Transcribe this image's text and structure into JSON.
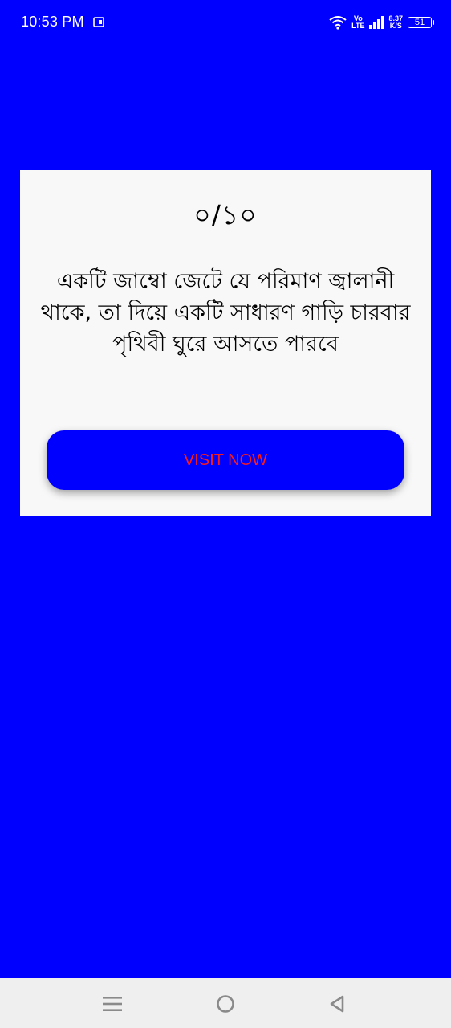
{
  "status_bar": {
    "time": "10:53 PM",
    "network_top": "Vo",
    "network_bottom": "LTE",
    "speed_top": "8.37",
    "speed_bottom": "K/S",
    "battery": "51"
  },
  "card": {
    "score": "০/১০",
    "question": "একটি জাম্বো জেটে যে পরিমাণ জ্বালানী থাকে, তা দিয়ে একটি সাধারণ গাড়ি চারবার পৃথিবী ঘুরে আসতে পারবে",
    "button_label": "VISIT NOW"
  },
  "colors": {
    "background": "#0000ff",
    "card": "#f8f8f8",
    "button_text": "#ff1a1a",
    "nav_bar": "#efefef"
  },
  "icons": [
    "notification-icon",
    "wifi-icon",
    "signal-icon",
    "battery-icon",
    "menu-icon",
    "home-icon",
    "back-icon"
  ]
}
